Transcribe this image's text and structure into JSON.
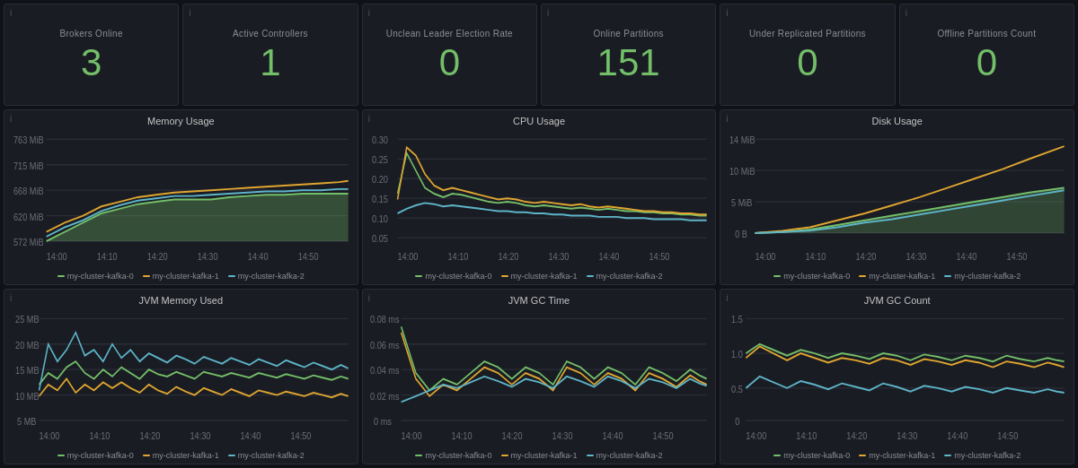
{
  "stats": [
    {
      "id": "brokers-online",
      "title": "Brokers Online",
      "value": "3"
    },
    {
      "id": "active-controllers",
      "title": "Active Controllers",
      "value": "1"
    },
    {
      "id": "unclean-leader",
      "title": "Unclean Leader Election Rate",
      "value": "0"
    },
    {
      "id": "online-partitions",
      "title": "Online Partitions",
      "value": "151"
    },
    {
      "id": "under-replicated",
      "title": "Under Replicated Partitions",
      "value": "0"
    },
    {
      "id": "offline-partitions",
      "title": "Offline Partitions Count",
      "value": "0"
    }
  ],
  "charts_row1": [
    {
      "id": "memory-usage",
      "title": "Memory Usage",
      "yLabels": [
        "763 MiB",
        "715 MiB",
        "668 MiB",
        "620 MiB",
        "572 MiB"
      ],
      "xLabels": [
        "14:00",
        "14:10",
        "14:20",
        "14:30",
        "14:40",
        "14:50"
      ]
    },
    {
      "id": "cpu-usage",
      "title": "CPU Usage",
      "yLabels": [
        "0.30",
        "0.25",
        "0.20",
        "0.15",
        "0.10",
        "0.05"
      ],
      "xLabels": [
        "14:00",
        "14:10",
        "14:20",
        "14:30",
        "14:40",
        "14:50"
      ]
    },
    {
      "id": "disk-usage",
      "title": "Disk Usage",
      "yLabels": [
        "14 MiB",
        "10 MiB",
        "5 MiB",
        "0 B"
      ],
      "xLabels": [
        "14:00",
        "14:10",
        "14:20",
        "14:30",
        "14:40",
        "14:50"
      ]
    }
  ],
  "charts_row2": [
    {
      "id": "jvm-memory-used",
      "title": "JVM Memory Used",
      "yLabels": [
        "25 MB",
        "20 MB",
        "15 MB",
        "10 MB",
        "5 MB"
      ],
      "xLabels": [
        "14:00",
        "14:10",
        "14:20",
        "14:30",
        "14:40",
        "14:50"
      ]
    },
    {
      "id": "jvm-gc-time",
      "title": "JVM GC Time",
      "yLabels": [
        "0.08 ms",
        "0.06 ms",
        "0.04 ms",
        "0.02 ms",
        "0 ms"
      ],
      "xLabels": [
        "14:00",
        "14:10",
        "14:20",
        "14:30",
        "14:40",
        "14:50"
      ]
    },
    {
      "id": "jvm-gc-count",
      "title": "JVM GC Count",
      "yLabels": [
        "1.5",
        "1.0",
        "0.5",
        "0"
      ],
      "xLabels": [
        "14:00",
        "14:10",
        "14:20",
        "14:30",
        "14:40",
        "14:50"
      ]
    }
  ],
  "legend": [
    {
      "label": "my-cluster-kafka-0",
      "color": "#73bf69"
    },
    {
      "label": "my-cluster-kafka-1",
      "color": "#e0a630"
    },
    {
      "label": "my-cluster-kafka-2",
      "color": "#5db5c9"
    }
  ]
}
